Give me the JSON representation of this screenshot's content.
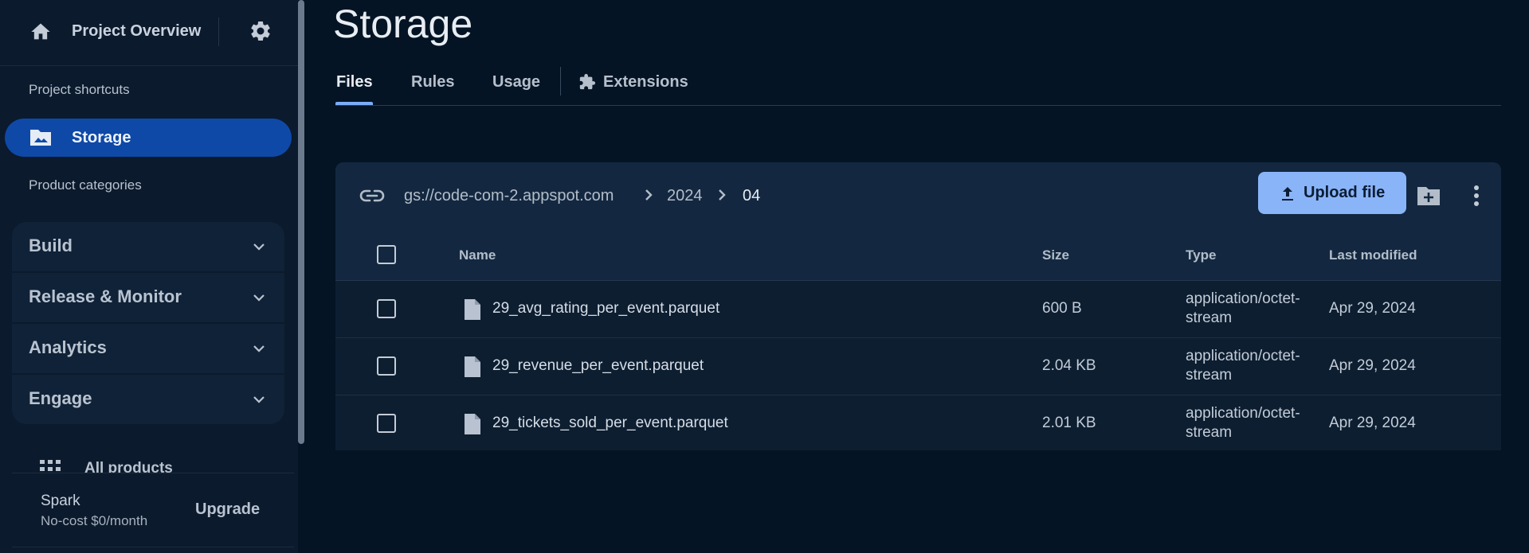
{
  "sidebar": {
    "project_title": "Project Overview",
    "shortcuts_heading": "Project shortcuts",
    "active_item": "Storage",
    "categories_heading": "Product categories",
    "categories": [
      {
        "label": "Build"
      },
      {
        "label": "Release & Monitor"
      },
      {
        "label": "Analytics"
      },
      {
        "label": "Engage"
      }
    ],
    "all_products": "All products",
    "plan": {
      "name": "Spark",
      "price": "No-cost $0/month",
      "upgrade": "Upgrade"
    }
  },
  "page": {
    "title": "Storage",
    "tabs": [
      {
        "label": "Files",
        "active": true
      },
      {
        "label": "Rules"
      },
      {
        "label": "Usage"
      },
      {
        "label": "Extensions",
        "icon": "extension-icon"
      }
    ]
  },
  "browser": {
    "breadcrumb": [
      "gs://code-com-2.appspot.com",
      "2024",
      "04"
    ],
    "upload_label": "Upload file",
    "columns": {
      "name": "Name",
      "size": "Size",
      "type": "Type",
      "modified": "Last modified"
    },
    "files": [
      {
        "name": "29_avg_rating_per_event.parquet",
        "size": "600 B",
        "type_line1": "application/octet-",
        "type_line2": "stream",
        "modified": "Apr 29, 2024"
      },
      {
        "name": "29_revenue_per_event.parquet",
        "size": "2.04 KB",
        "type_line1": "application/octet-",
        "type_line2": "stream",
        "modified": "Apr 29, 2024"
      },
      {
        "name": "29_tickets_sold_per_event.parquet",
        "size": "2.01 KB",
        "type_line1": "application/octet-",
        "type_line2": "stream",
        "modified": "Apr 29, 2024"
      }
    ]
  },
  "colors": {
    "accent": "#8ab4f8",
    "active_nav": "#0e49a8",
    "background": "#041424"
  }
}
